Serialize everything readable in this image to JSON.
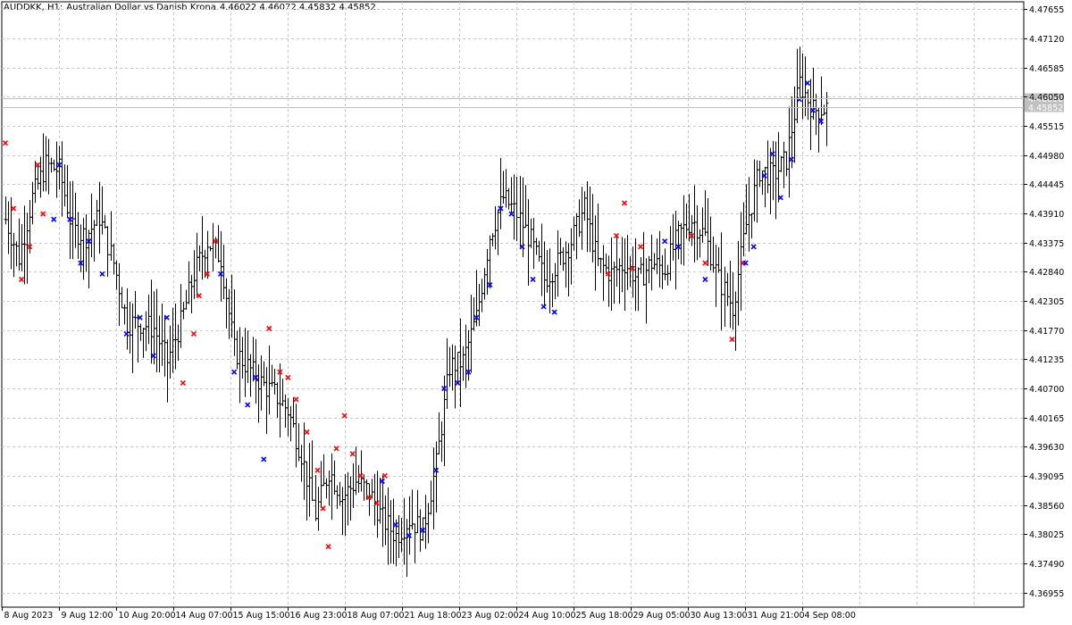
{
  "header": {
    "symbol_tf": "AUDDKK, H1:",
    "description": "Australian Dollar vs Danish Krona",
    "ohlc": "4.46022 4.46072 4.45832 4.45852"
  },
  "colors": {
    "background": "#ffffff",
    "grid": "#c8c8c8",
    "bars": "#000000",
    "sell_marker": "#ff0000",
    "buy_marker": "#0000ff",
    "price_line": "#c0c0c0",
    "price_label_bg": "#c0c0c0",
    "price_label_text": "#ffffff"
  },
  "chart_data": {
    "type": "ohlc",
    "timeframe": "H1",
    "ylim": [
      4.3669,
      4.4779
    ],
    "y_ticks": [
      "4.47655",
      "4.47120",
      "4.46585",
      "4.46050",
      "4.45515",
      "4.44980",
      "4.44445",
      "4.43910",
      "4.43375",
      "4.42840",
      "4.42305",
      "4.41770",
      "4.41235",
      "4.40700",
      "4.40165",
      "4.39630",
      "4.39095",
      "4.38560",
      "4.38025",
      "4.37490",
      "4.36955"
    ],
    "x_ticks": [
      "8 Aug 2023",
      "9 Aug 12:00",
      "10 Aug 20:00",
      "14 Aug 07:00",
      "15 Aug 15:00",
      "16 Aug 23:00",
      "18 Aug 07:00",
      "21 Aug 18:00",
      "23 Aug 02:00",
      "24 Aug 10:00",
      "25 Aug 18:00",
      "29 Aug 05:00",
      "30 Aug 13:00",
      "31 Aug 21:00",
      "4 Sep 08:00"
    ],
    "bar_count": 306,
    "price_labels": [
      "4.46016",
      "4.45852"
    ],
    "close_anchors": [
      [
        0,
        4.438
      ],
      [
        5,
        4.431
      ],
      [
        10,
        4.442
      ],
      [
        15,
        4.448
      ],
      [
        20,
        4.447
      ],
      [
        25,
        4.436
      ],
      [
        30,
        4.435
      ],
      [
        35,
        4.4385
      ],
      [
        40,
        4.43
      ],
      [
        45,
        4.419
      ],
      [
        50,
        4.419
      ],
      [
        55,
        4.418
      ],
      [
        60,
        4.412
      ],
      [
        65,
        4.419
      ],
      [
        70,
        4.428
      ],
      [
        75,
        4.434
      ],
      [
        80,
        4.431
      ],
      [
        85,
        4.414
      ],
      [
        90,
        4.411
      ],
      [
        95,
        4.408
      ],
      [
        100,
        4.406
      ],
      [
        105,
        4.403
      ],
      [
        110,
        4.395
      ],
      [
        115,
        4.384
      ],
      [
        120,
        4.392
      ],
      [
        125,
        4.387
      ],
      [
        130,
        4.39
      ],
      [
        135,
        4.388
      ],
      [
        140,
        4.383
      ],
      [
        145,
        4.38
      ],
      [
        150,
        4.383
      ],
      [
        155,
        4.381
      ],
      [
        160,
        4.393
      ],
      [
        165,
        4.411
      ],
      [
        170,
        4.412
      ],
      [
        175,
        4.42
      ],
      [
        180,
        4.435
      ],
      [
        185,
        4.442
      ],
      [
        190,
        4.439
      ],
      [
        195,
        4.434
      ],
      [
        200,
        4.427
      ],
      [
        205,
        4.43
      ],
      [
        210,
        4.434
      ],
      [
        215,
        4.44
      ],
      [
        220,
        4.43
      ],
      [
        225,
        4.428
      ],
      [
        230,
        4.43
      ],
      [
        235,
        4.427
      ],
      [
        240,
        4.43
      ],
      [
        245,
        4.429
      ],
      [
        250,
        4.435
      ],
      [
        255,
        4.438
      ],
      [
        260,
        4.435
      ],
      [
        265,
        4.427
      ],
      [
        270,
        4.422
      ],
      [
        275,
        4.437
      ],
      [
        280,
        4.447
      ],
      [
        285,
        4.446
      ],
      [
        290,
        4.449
      ],
      [
        295,
        4.463
      ],
      [
        300,
        4.458
      ],
      [
        305,
        4.4585
      ]
    ],
    "sell_markers": [
      [
        0,
        4.452
      ],
      [
        3,
        4.44
      ],
      [
        6,
        4.427
      ],
      [
        9,
        4.433
      ],
      [
        12,
        4.448
      ],
      [
        14,
        4.439
      ],
      [
        66,
        4.408
      ],
      [
        70,
        4.417
      ],
      [
        72,
        4.424
      ],
      [
        75,
        4.428
      ],
      [
        78,
        4.434
      ],
      [
        98,
        4.418
      ],
      [
        102,
        4.41
      ],
      [
        105,
        4.409
      ],
      [
        108,
        4.405
      ],
      [
        112,
        4.399
      ],
      [
        116,
        4.392
      ],
      [
        118,
        4.385
      ],
      [
        120,
        4.378
      ],
      [
        123,
        4.396
      ],
      [
        126,
        4.402
      ],
      [
        129,
        4.395
      ],
      [
        132,
        4.391
      ],
      [
        135,
        4.387
      ],
      [
        138,
        4.386
      ],
      [
        141,
        4.391
      ],
      [
        224,
        4.428
      ],
      [
        227,
        4.435
      ],
      [
        230,
        4.441
      ],
      [
        233,
        4.429
      ],
      [
        236,
        4.433
      ],
      [
        255,
        4.435
      ],
      [
        260,
        4.43
      ],
      [
        270,
        4.416
      ],
      [
        274,
        4.43
      ]
    ],
    "buy_markers": [
      [
        18,
        4.438
      ],
      [
        20,
        4.448
      ],
      [
        24,
        4.438
      ],
      [
        28,
        4.43
      ],
      [
        31,
        4.434
      ],
      [
        36,
        4.428
      ],
      [
        45,
        4.417
      ],
      [
        50,
        4.42
      ],
      [
        55,
        4.413
      ],
      [
        60,
        4.42
      ],
      [
        80,
        4.428
      ],
      [
        85,
        4.41
      ],
      [
        90,
        4.404
      ],
      [
        93,
        4.409
      ],
      [
        96,
        4.394
      ],
      [
        140,
        4.39
      ],
      [
        145,
        4.382
      ],
      [
        150,
        4.38
      ],
      [
        155,
        4.381
      ],
      [
        160,
        4.392
      ],
      [
        163,
        4.407
      ],
      [
        168,
        4.408
      ],
      [
        172,
        4.41
      ],
      [
        175,
        4.42
      ],
      [
        180,
        4.426
      ],
      [
        184,
        4.44
      ],
      [
        188,
        4.439
      ],
      [
        192,
        4.433
      ],
      [
        196,
        4.427
      ],
      [
        200,
        4.422
      ],
      [
        204,
        4.421
      ],
      [
        245,
        4.434
      ],
      [
        250,
        4.433
      ],
      [
        260,
        4.427
      ],
      [
        275,
        4.43
      ],
      [
        278,
        4.433
      ],
      [
        282,
        4.446
      ],
      [
        285,
        4.45
      ],
      [
        288,
        4.442
      ],
      [
        292,
        4.449
      ],
      [
        295,
        4.46
      ],
      [
        298,
        4.463
      ],
      [
        300,
        4.458
      ],
      [
        303,
        4.456
      ]
    ]
  }
}
